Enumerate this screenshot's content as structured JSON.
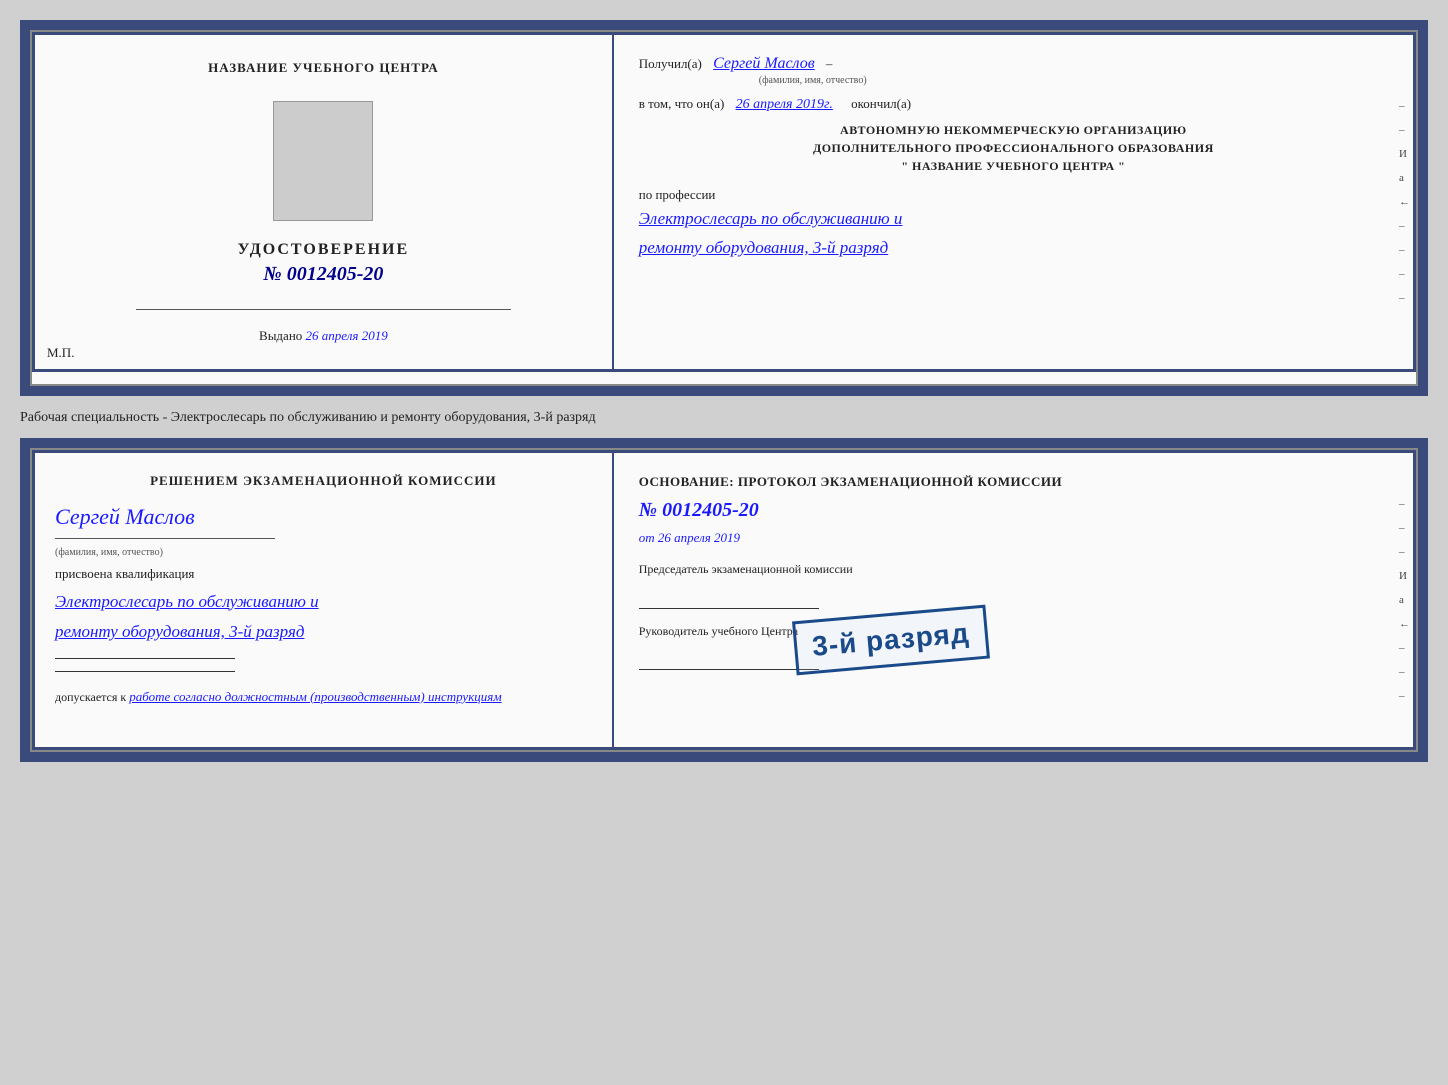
{
  "top_cert": {
    "left": {
      "center_title": "НАЗВАНИЕ УЧЕБНОГО ЦЕНТРА",
      "photo_alt": "photo placeholder",
      "udostoverenie_label": "УДОСТОВЕРЕНИЕ",
      "number_prefix": "№",
      "number": "0012405-20",
      "vydano_label": "Выдано",
      "vydano_date": "26 апреля 2019",
      "mp_label": "М.П."
    },
    "right": {
      "poluchil_label": "Получил(а)",
      "recipient_name": "Сергей Маслов",
      "fio_label": "(фамилия, имя, отчество)",
      "dash": "–",
      "vtom_label": "в том, что он(а)",
      "date_handwritten": "26 апреля 2019г.",
      "okonchil_label": "окончил(а)",
      "org_line1": "АВТОНОМНУЮ НЕКОММЕРЧЕСКУЮ ОРГАНИЗАЦИЮ",
      "org_line2": "ДОПОЛНИТЕЛЬНОГО ПРОФЕССИОНАЛЬНОГО ОБРАЗОВАНИЯ",
      "org_line3": "\"   НАЗВАНИЕ УЧЕБНОГО ЦЕНТРА   \"",
      "po_professii_label": "по профессии",
      "profession_line1": "Электрослесарь по обслуживанию и",
      "profession_line2": "ремонту оборудования, 3-й разряд"
    }
  },
  "middle_text": "Рабочая специальность - Электрослесарь по обслуживанию и ремонту оборудования, 3-й разряд",
  "bottom_cert": {
    "left": {
      "resheniyem_title": "Решением  экзаменационной  комиссии",
      "name_handwritten": "Сергей Маслов",
      "fio_label": "(фамилия, имя, отчество)",
      "prisvoena_label": "присвоена квалификация",
      "profession_line1": "Электрослесарь по обслуживанию и",
      "profession_line2": "ремонту оборудования, 3-й разряд",
      "dopuskaetsya_label": "допускается к",
      "dopuskaetsya_text": "работе согласно должностным (производственным) инструкциям"
    },
    "right": {
      "osnovanie_label": "Основание: протокол экзаменационной  комиссии",
      "number_prefix": "№",
      "protocol_number": "0012405-20",
      "ot_label": "от",
      "ot_date": "26 апреля 2019",
      "chairman_label": "Председатель экзаменационной комиссии",
      "chairman_sign_line": "",
      "rukovoditel_label": "Руководитель учебного Центра",
      "rukovoditel_sign_line": ""
    },
    "stamp": {
      "text": "3-й разряд"
    }
  }
}
